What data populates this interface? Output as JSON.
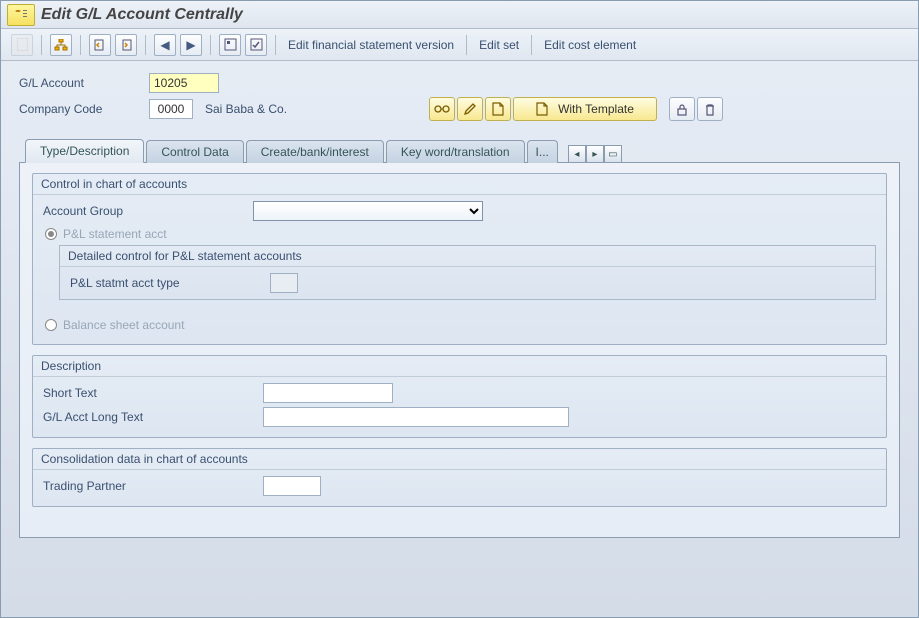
{
  "title": "Edit G/L Account Centrally",
  "toolbar": {
    "edit_fin": "Edit financial statement version",
    "edit_set": "Edit set",
    "edit_cost": "Edit cost element"
  },
  "header": {
    "gl_account_label": "G/L Account",
    "gl_account_value": "10205",
    "company_code_label": "Company Code",
    "company_code_value": "0000",
    "company_name": "Sai Baba & Co.",
    "with_template": "With Template"
  },
  "tabs": {
    "t1": "Type/Description",
    "t2": "Control Data",
    "t3": "Create/bank/interest",
    "t4": "Key word/translation",
    "t5": "I..."
  },
  "group1": {
    "title": "Control in chart of accounts",
    "account_group_label": "Account Group",
    "account_group_value": "",
    "pl_radio": "P&L statement acct",
    "sub_title": "Detailed control for P&L statement accounts",
    "pl_type_label": "P&L statmt acct type",
    "bs_radio": "Balance sheet account"
  },
  "group2": {
    "title": "Description",
    "short_text_label": "Short Text",
    "short_text_value": "",
    "long_text_label": "G/L Acct Long Text",
    "long_text_value": ""
  },
  "group3": {
    "title": "Consolidation data in chart of accounts",
    "partner_label": "Trading Partner",
    "partner_value": ""
  }
}
